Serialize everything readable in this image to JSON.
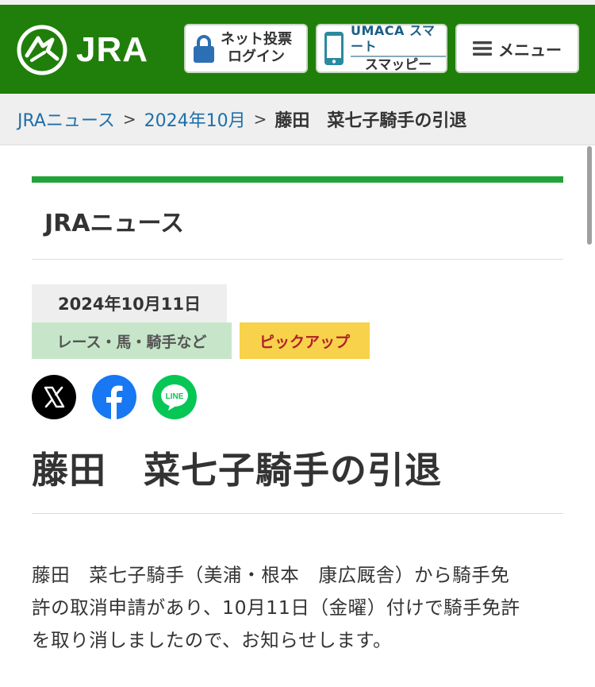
{
  "header": {
    "logo_text": "JRA",
    "login": {
      "line1": "ネット投票",
      "line2": "ログイン"
    },
    "umaca": {
      "line1": "UMACA スマート",
      "line2": "スマッピー"
    },
    "menu_label": "メニュー",
    "colors": {
      "bg": "#1f7f0a",
      "icon_blue": "#2d6fb3"
    }
  },
  "breadcrumb": {
    "items": [
      {
        "label": "JRAニュース"
      },
      {
        "label": "2024年10月"
      }
    ],
    "separator": ">",
    "current": "藤田　菜七子騎手の引退"
  },
  "section_title": "JRAニュース",
  "article": {
    "date": "2024年10月11日",
    "tags": [
      "レース・馬・騎手など",
      "ピックアップ"
    ],
    "title": "藤田　菜七子騎手の引退",
    "body": "藤田　菜七子騎手（美浦・根本　康広厩舎）から騎手免\n許の取消申請があり、10月11日（金曜）付けで騎手免許\nを取り消しましたので、お知らせします。"
  },
  "share": {
    "icons": [
      "x-icon",
      "facebook-icon",
      "line-icon"
    ],
    "line_label": "LINE"
  },
  "colors": {
    "accent_green": "#22a33a",
    "tag_category_bg": "#c7e6c9",
    "tag_pickup_bg": "#f7d24a",
    "tag_pickup_text": "#b0202a",
    "link_blue": "#1f6fa8"
  }
}
